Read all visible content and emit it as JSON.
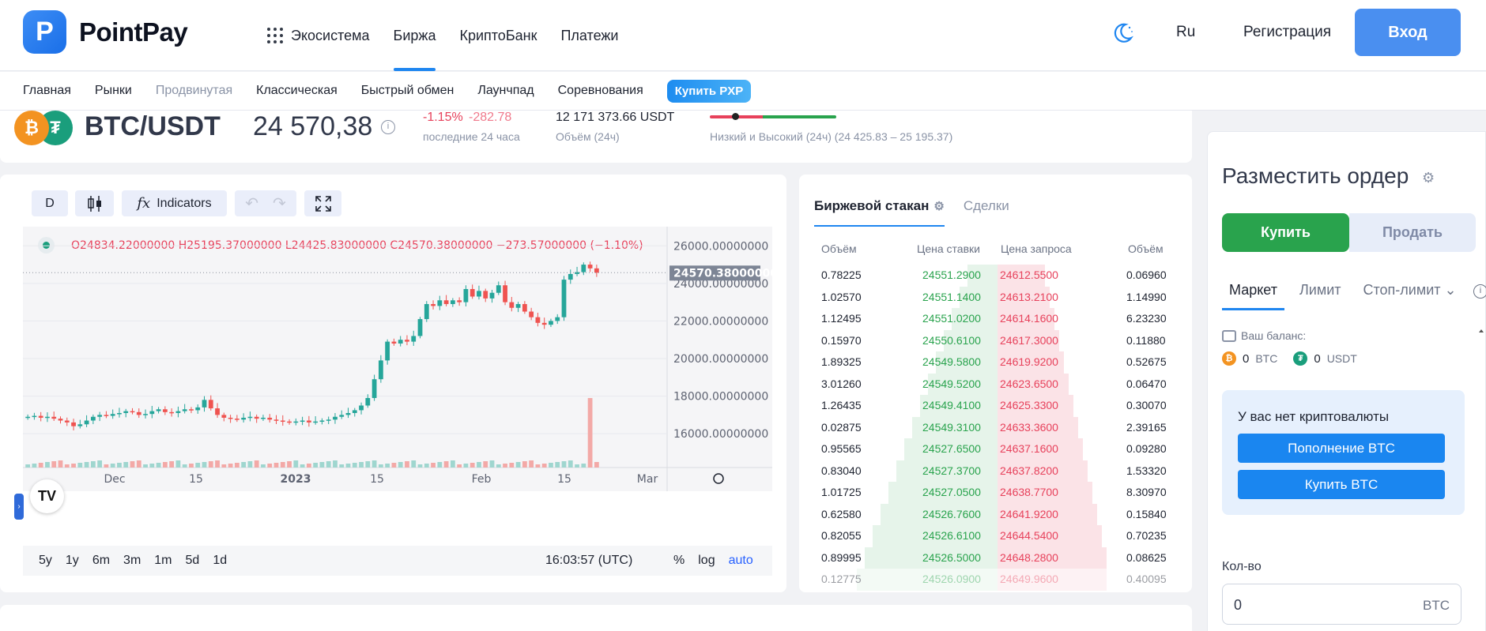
{
  "brand": {
    "name": "PointPay"
  },
  "nav": {
    "items": [
      {
        "label": "Экосистема"
      },
      {
        "label": "Биржа"
      },
      {
        "label": "КриптоБанк"
      },
      {
        "label": "Платежи"
      }
    ],
    "lang": "Ru",
    "register": "Регистрация",
    "login": "Вход"
  },
  "subnav": {
    "items": [
      {
        "label": "Главная"
      },
      {
        "label": "Рынки"
      },
      {
        "label": "Продвинутая"
      },
      {
        "label": "Классическая"
      },
      {
        "label": "Быстрый обмен"
      },
      {
        "label": "Лаунчпад"
      },
      {
        "label": "Соревнования"
      }
    ],
    "buy_pxp": "Купить PXP"
  },
  "ticker": {
    "pair": "BTC/USDT",
    "price": "24 570,38",
    "change_pct": "-1.15%",
    "change_abs": "-282.78",
    "change_label": "последние 24 часа",
    "volume": "12 171 373.66 USDT",
    "volume_label": "Объём (24ч)",
    "hl_label": "Низкий и Высокий (24ч) (24 425.83 – 25 195.37)",
    "range_position": 0.18
  },
  "chart": {
    "interval": "D",
    "indicators_label": "Indicators",
    "ohlc": "O24834.22000000  H25195.37000000  L24425.83000000  C24570.38000000  −273.57000000  (−1.10%)",
    "last_price_label": "24570.38000000",
    "ranges": [
      "5y",
      "1y",
      "6m",
      "3m",
      "1m",
      "5d",
      "1d"
    ],
    "clock": "16:03:57 (UTC)",
    "scale": {
      "percent": "%",
      "log": "log",
      "auto": "auto"
    },
    "colors": {
      "up": "#26a69a",
      "down": "#ef5350"
    }
  },
  "chart_data": {
    "type": "candlestick",
    "y_ticks": [
      "26000.00000000",
      "24000.00000000",
      "22000.00000000",
      "20000.00000000",
      "18000.00000000",
      "16000.00000000"
    ],
    "x_ticks": [
      "Dec",
      "15",
      "2023",
      "15",
      "Feb",
      "15",
      "Mar"
    ],
    "ylim": [
      14200,
      26600
    ],
    "last_price": 24570.38,
    "closes": [
      16900,
      16950,
      16850,
      16900,
      16800,
      16700,
      16600,
      16400,
      16500,
      16700,
      16900,
      17000,
      16950,
      17050,
      17100,
      17200,
      17150,
      17000,
      17050,
      17200,
      17300,
      17150,
      17100,
      17200,
      17300,
      17250,
      17400,
      17800,
      17350,
      17000,
      16850,
      16800,
      16750,
      16850,
      16900,
      16800,
      16850,
      16750,
      16700,
      16650,
      16600,
      16650,
      16700,
      16600,
      16650,
      16700,
      16750,
      16900,
      17000,
      17100,
      17250,
      17500,
      17900,
      18900,
      19900,
      20900,
      20800,
      21000,
      20900,
      21200,
      22100,
      22900,
      22800,
      23100,
      22900,
      23100,
      23000,
      23700,
      23300,
      23600,
      23200,
      23500,
      23900,
      23000,
      22700,
      22900,
      22500,
      22200,
      21900,
      21800,
      22000,
      22200,
      24200,
      24500,
      24600,
      25000,
      24800,
      24570
    ]
  },
  "order_book": {
    "tabs": [
      "Биржевой стакан",
      "Сделки"
    ],
    "headers": [
      "Объём",
      "Цена ставки",
      "Цена запроса",
      "Объём"
    ],
    "rows": [
      [
        "0.78225",
        "24551.2900",
        "24612.5500",
        "0.06960"
      ],
      [
        "1.02570",
        "24551.1400",
        "24613.2100",
        "1.14990"
      ],
      [
        "1.12495",
        "24551.0200",
        "24614.1600",
        "6.23230"
      ],
      [
        "0.15970",
        "24550.6100",
        "24617.3000",
        "0.11880"
      ],
      [
        "1.89325",
        "24549.5800",
        "24619.9200",
        "0.52675"
      ],
      [
        "3.01260",
        "24549.5200",
        "24623.6500",
        "0.06470"
      ],
      [
        "1.26435",
        "24549.4100",
        "24625.3300",
        "0.30070"
      ],
      [
        "0.02875",
        "24549.3100",
        "24633.3600",
        "2.39165"
      ],
      [
        "0.95565",
        "24527.6500",
        "24637.1600",
        "0.09280"
      ],
      [
        "0.83040",
        "24527.3700",
        "24637.8200",
        "1.53320"
      ],
      [
        "1.01725",
        "24527.0500",
        "24638.7700",
        "8.30970"
      ],
      [
        "0.62580",
        "24526.7600",
        "24641.9200",
        "0.15840"
      ],
      [
        "0.82055",
        "24526.6100",
        "24644.5400",
        "0.70235"
      ],
      [
        "0.89995",
        "24526.5000",
        "24648.2800",
        "0.08625"
      ],
      [
        "0.12775",
        "24526.0900",
        "24649.9600",
        "0.40095"
      ]
    ]
  },
  "order": {
    "title": "Разместить ордер",
    "buy": "Купить",
    "sell": "Продать",
    "tabs": [
      "Маркет",
      "Лимит",
      "Стоп-лимит"
    ],
    "balance_label": "Ваш баланс:",
    "btc_balance": "0",
    "btc_unit": "BTC",
    "usdt_balance": "0",
    "usdt_unit": "USDT",
    "no_crypto": "У вас нет криптовалюты",
    "deposit_btc": "Пополнение BTC",
    "buy_btc": "Купить BTC",
    "qty_label": "Кол-во",
    "qty_value": "0",
    "qty_unit": "BTC"
  }
}
